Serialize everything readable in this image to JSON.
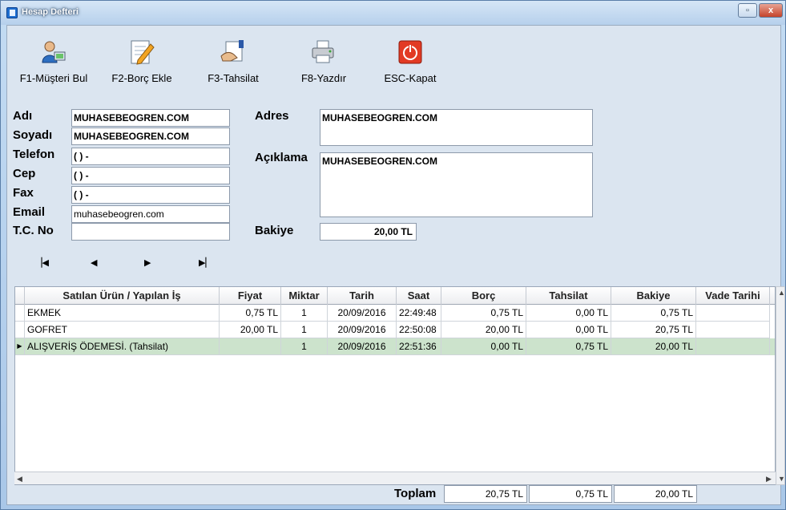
{
  "window": {
    "title": "Hesap Defteri",
    "restore_icon": "restore-icon",
    "close_glyph": "x"
  },
  "toolbar": [
    {
      "label": "F1-Müşteri Bul",
      "icon": "customer-search-icon"
    },
    {
      "label": "F2-Borç Ekle",
      "icon": "edit-pencil-icon"
    },
    {
      "label": "F3-Tahsilat",
      "icon": "payment-hand-icon"
    },
    {
      "label": "F8-Yazdır",
      "icon": "printer-icon"
    },
    {
      "label": "ESC-Kapat",
      "icon": "power-icon"
    }
  ],
  "form": {
    "labels": {
      "adi": "Adı",
      "soyadi": "Soyadı",
      "telefon": "Telefon",
      "cep": "Cep",
      "fax": "Fax",
      "email": "Email",
      "tcno": "T.C. No",
      "adres": "Adres",
      "aciklama": "Açıklama",
      "bakiye": "Bakiye"
    },
    "values": {
      "adi": "MUHASEBEOGREN.COM",
      "soyadi": "MUHASEBEOGREN.COM",
      "telefon": "(   )   -",
      "cep": "(   )   -",
      "fax": "(   )   -",
      "email": "muhasebeogren.com",
      "tcno": "",
      "adres": "MUHASEBEOGREN.COM",
      "aciklama": "MUHASEBEOGREN.COM",
      "bakiye": "20,00 TL"
    }
  },
  "navigator": {
    "first": "◀◀",
    "prev": "◀",
    "next": "▶",
    "last": "▶▶"
  },
  "table": {
    "columns": [
      "Satılan Ürün / Yapılan İş",
      "Fiyat",
      "Miktar",
      "Tarih",
      "Saat",
      "Borç",
      "Tahsilat",
      "Bakiye",
      "Vade Tarihi"
    ],
    "rows": [
      {
        "urun": "EKMEK",
        "fiyat": "0,75 TL",
        "miktar": "1",
        "tarih": "20/09/2016",
        "saat": "22:49:48",
        "borc": "0,75 TL",
        "tahsilat": "0,00 TL",
        "bakiye": "0,75 TL",
        "vade": ""
      },
      {
        "urun": "GOFRET",
        "fiyat": "20,00 TL",
        "miktar": "1",
        "tarih": "20/09/2016",
        "saat": "22:50:08",
        "borc": "20,00 TL",
        "tahsilat": "0,00 TL",
        "bakiye": "20,75 TL",
        "vade": ""
      },
      {
        "urun": "ALIŞVERİŞ ÖDEMESİ. (Tahsilat)",
        "fiyat": "",
        "miktar": "1",
        "tarih": "20/09/2016",
        "saat": "22:51:36",
        "borc": "0,00 TL",
        "tahsilat": "0,75 TL",
        "bakiye": "20,00 TL",
        "vade": ""
      }
    ]
  },
  "totals": {
    "label": "Toplam",
    "borc": "20,75 TL",
    "tahsilat": "0,75 TL",
    "bakiye": "20,00 TL"
  }
}
